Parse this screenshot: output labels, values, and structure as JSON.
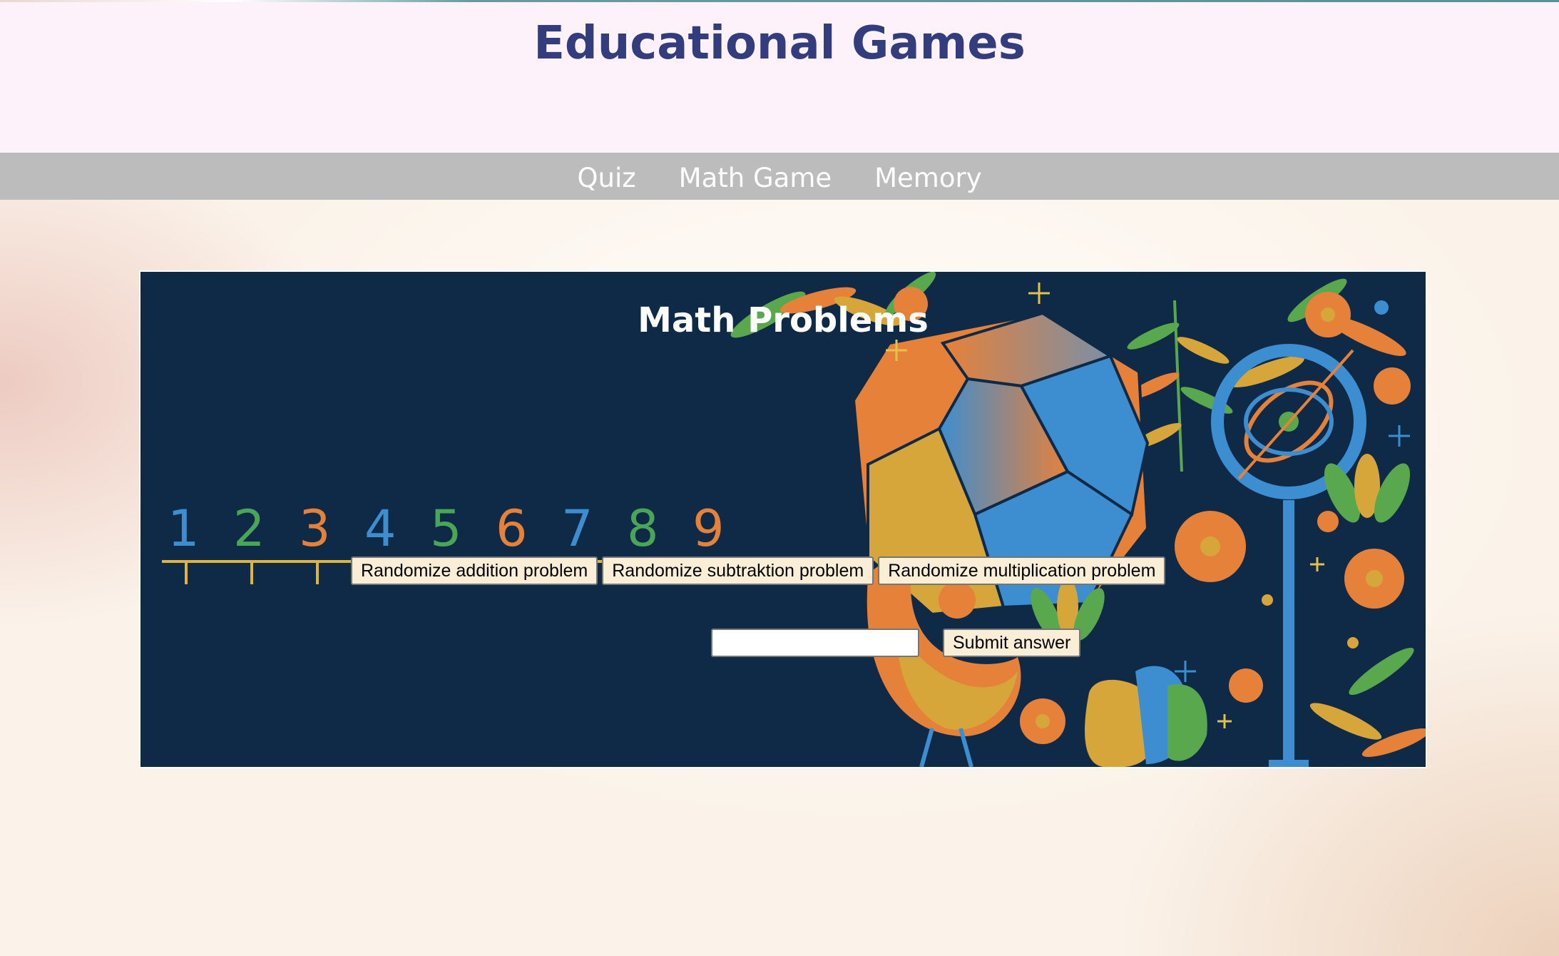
{
  "header": {
    "title": "Educational Games"
  },
  "nav": {
    "items": [
      {
        "label": "Quiz"
      },
      {
        "label": "Math Game"
      },
      {
        "label": "Memory"
      }
    ]
  },
  "game": {
    "title": "Math Problems",
    "number_line": [
      "1",
      "2",
      "3",
      "4",
      "5",
      "6",
      "7",
      "8",
      "9"
    ],
    "buttons": {
      "addition": "Randomize addition problem",
      "subtraction": "Randomize subtraktion problem",
      "multiplication": "Randomize multiplication problem"
    },
    "answer": {
      "value": "",
      "placeholder": ""
    },
    "submit_label": "Submit answer"
  },
  "colors": {
    "title": "#333d7e",
    "header_bg": "#fdf1fa",
    "nav_bg": "#bcbcbc",
    "panel_bg": "#0f2a47",
    "button_bg": "#fbeed7",
    "num_blue": "#3d8ed0",
    "num_green": "#4aa657",
    "num_orange": "#e6813a",
    "line_yellow": "#e2b33a"
  }
}
